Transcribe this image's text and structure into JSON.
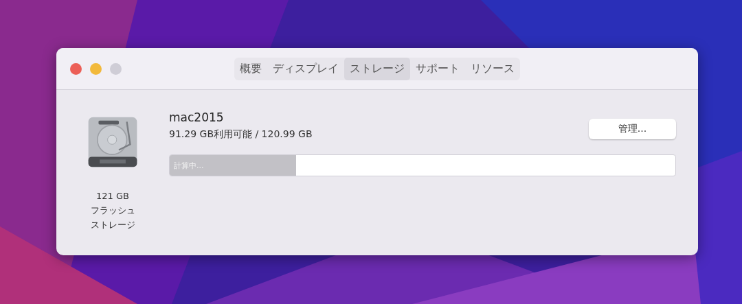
{
  "window": {
    "traffic_lights": [
      {
        "color": "#ec5f57"
      },
      {
        "color": "#f2b93b"
      },
      {
        "color": "#cfcdd6"
      }
    ]
  },
  "tabs": [
    {
      "label": "概要",
      "selected": false
    },
    {
      "label": "ディスプレイ",
      "selected": false
    },
    {
      "label": "ストレージ",
      "selected": true
    },
    {
      "label": "サポート",
      "selected": false
    },
    {
      "label": "リソース",
      "selected": false
    }
  ],
  "disk": {
    "capacity": "121 GB",
    "type_lines": [
      "フラッシュ",
      "ストレージ"
    ],
    "name": "mac2015",
    "usage": "91.29 GB利用可能 / 120.99 GB",
    "bar": {
      "level": 0.25,
      "label": "計算中..."
    },
    "manage_button": "管理..."
  }
}
